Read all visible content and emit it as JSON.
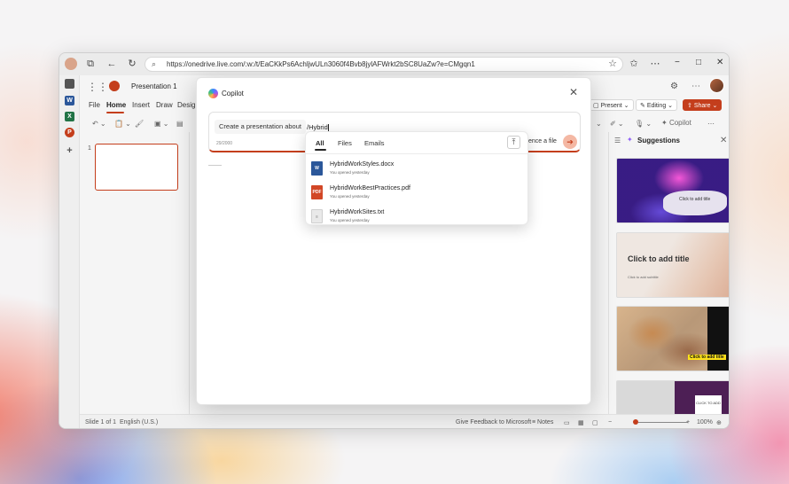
{
  "browser": {
    "url": "https://onedrive.live.com/:w:/t/EaCKkPs6AchljwULn3060f4Bvb8jylAFWrkt2bSC8UaZw?e=CMgqn1",
    "icons": [
      "profile-icon",
      "tabs-icon",
      "back-icon",
      "refresh-icon",
      "search-icon",
      "favorite-icon",
      "star-icon",
      "more-icon"
    ],
    "window_controls": [
      "−",
      "□",
      "✕"
    ]
  },
  "app": {
    "document_title": "Presentation 1",
    "menu": [
      "File",
      "Home",
      "Insert",
      "Draw",
      "Design"
    ],
    "active_menu": "Home",
    "present_label": "Present",
    "editing_label": "Editing",
    "share_label": "Share",
    "copilot_label": "Copilot",
    "slide_number": "1"
  },
  "status": {
    "slide_of": "Slide 1 of 1",
    "language": "English (U.S.)",
    "feedback": "Give Feedback to Microsoft",
    "notes": "Notes",
    "zoom": "100%",
    "zoom_level_percent": 100
  },
  "copilot": {
    "title": "Copilot",
    "prompt_chip": "Create a presentation about",
    "prompt_text": "/Hybrid",
    "counter": "29/2000",
    "reference_text": "ence a file",
    "send_icon": "arrow-right-icon",
    "dropdown": {
      "tabs": [
        "All",
        "Files",
        "Emails"
      ],
      "active_tab": "All",
      "files": [
        {
          "name": "HybridWorkStyles.docx",
          "meta": "You opened yesterday",
          "type": "word",
          "icon_color": "#2b579a"
        },
        {
          "name": "HybridWorkBestPractices.pdf",
          "meta": "You opened yesterday",
          "type": "pdf",
          "icon_color": "#d24726"
        },
        {
          "name": "HybridWorkSites.txt",
          "meta": "You opened yesterday",
          "type": "txt",
          "icon_color": "#9a9a9a"
        }
      ]
    }
  },
  "suggestions": {
    "title": "Suggestions",
    "cards": [
      {
        "text": "Click to add title"
      },
      {
        "title": "Click to add title",
        "subtitle": "Click to add subtitle"
      },
      {
        "text": "Click to add title"
      },
      {
        "text": "CLICK TO ADD"
      }
    ]
  },
  "colors": {
    "accent": "#c43e1c",
    "word": "#2b579a",
    "excel": "#217346",
    "ppt": "#c43e1c"
  }
}
